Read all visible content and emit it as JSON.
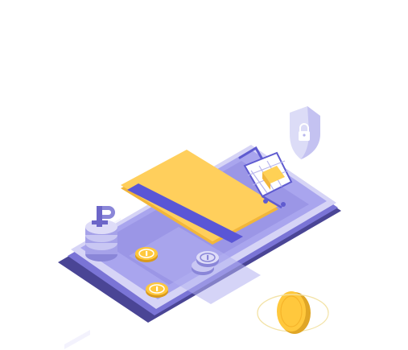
{
  "illustration": {
    "subject": "secure-mobile-payment",
    "currency_symbol": "₽",
    "coin_mark": "1"
  },
  "colors": {
    "background": "#ffffff",
    "phone_shadow": "#4a4595",
    "phone_body": "#6c66c8",
    "phone_body_light": "#d6d4f6",
    "phone_screen": "#a9a5ee",
    "phone_screen_inner": "#9b96e6",
    "card_yellow": "#ffcf5c",
    "card_yellow_dark": "#f2b63a",
    "card_stripe": "#5a56d6",
    "coin_gold": "#ffc83d",
    "coin_gold_dark": "#d99a1c",
    "coin_lavender": "#c9c7f3",
    "coin_lavender_dark": "#8a86d8",
    "shield": "#dcdcf7",
    "shield_dark": "#b8b6ec",
    "cart_frame": "#5f5bd0",
    "cart_basket": "#ffffff",
    "cart_box": "#ffd155",
    "orbit_line": "#f3e3a8"
  },
  "icons": {
    "shield": "lock-shield-icon",
    "cart": "shopping-cart-icon",
    "coin": "coin-icon",
    "currency": "ruble-icon"
  }
}
